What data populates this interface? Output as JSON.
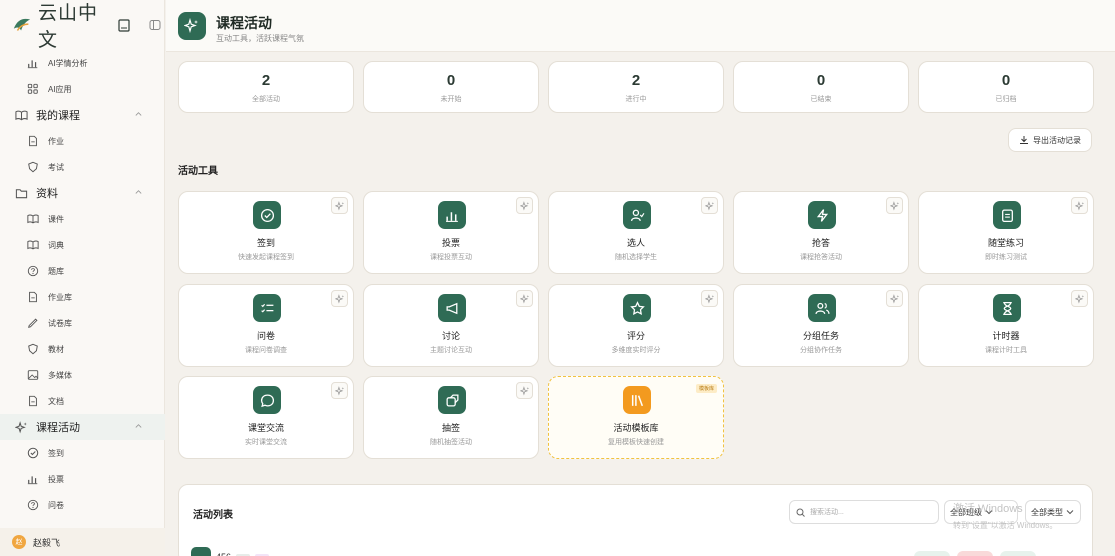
{
  "brand": {
    "name": "云山中文"
  },
  "sidebar": {
    "items": [
      {
        "label": "AI学情分析",
        "icon": "bar-chart-icon",
        "type": "item"
      },
      {
        "label": "AI应用",
        "icon": "grid-icon",
        "type": "item"
      },
      {
        "label": "我的课程",
        "icon": "book-open-icon",
        "type": "group"
      },
      {
        "label": "作业",
        "icon": "file-icon",
        "type": "item"
      },
      {
        "label": "考试",
        "icon": "shield-icon",
        "type": "item"
      },
      {
        "label": "资料",
        "icon": "folder-icon",
        "type": "group"
      },
      {
        "label": "课件",
        "icon": "book-open-icon",
        "type": "item"
      },
      {
        "label": "词典",
        "icon": "book-open-icon",
        "type": "item"
      },
      {
        "label": "题库",
        "icon": "help-circle-icon",
        "type": "item"
      },
      {
        "label": "作业库",
        "icon": "file-icon",
        "type": "item"
      },
      {
        "label": "试卷库",
        "icon": "pen-icon",
        "type": "item"
      },
      {
        "label": "教材",
        "icon": "shield-icon",
        "type": "item"
      },
      {
        "label": "多媒体",
        "icon": "image-icon",
        "type": "item"
      },
      {
        "label": "文档",
        "icon": "file-icon",
        "type": "item"
      },
      {
        "label": "课程活动",
        "icon": "sparkle-icon",
        "type": "group",
        "active": true
      },
      {
        "label": "签到",
        "icon": "check-circle-icon",
        "type": "item"
      },
      {
        "label": "投票",
        "icon": "bar-chart-icon",
        "type": "item"
      },
      {
        "label": "问卷",
        "icon": "help-circle-icon",
        "type": "item"
      }
    ]
  },
  "user": {
    "avatar_initial": "赵",
    "name": "赵毅飞"
  },
  "header": {
    "title": "课程活动",
    "subtitle": "互动工具，活跃课程气氛"
  },
  "stats": [
    {
      "value": "2",
      "label": "全部活动"
    },
    {
      "value": "0",
      "label": "未开始"
    },
    {
      "value": "2",
      "label": "进行中"
    },
    {
      "value": "0",
      "label": "已结束"
    },
    {
      "value": "0",
      "label": "已归档"
    }
  ],
  "export_label": "导出活动记录",
  "tools_title": "活动工具",
  "tools": [
    {
      "name": "签到",
      "desc": "快速发起课程签到",
      "icon": "check-circle-icon"
    },
    {
      "name": "投票",
      "desc": "课程投票互动",
      "icon": "bar-chart-icon"
    },
    {
      "name": "选人",
      "desc": "随机选择学生",
      "icon": "user-pick-icon"
    },
    {
      "name": "抢答",
      "desc": "课程抢答活动",
      "icon": "lightning-icon"
    },
    {
      "name": "随堂练习",
      "desc": "即时练习测试",
      "icon": "clipboard-icon"
    },
    {
      "name": "问卷",
      "desc": "课程问卷调查",
      "icon": "checklist-icon"
    },
    {
      "name": "讨论",
      "desc": "主题讨论互动",
      "icon": "megaphone-icon"
    },
    {
      "name": "评分",
      "desc": "多维度实时评分",
      "icon": "star-icon"
    },
    {
      "name": "分组任务",
      "desc": "分组协作任务",
      "icon": "users-icon"
    },
    {
      "name": "计时器",
      "desc": "课程计时工具",
      "icon": "hourglass-icon"
    },
    {
      "name": "课堂交流",
      "desc": "实时课堂交流",
      "icon": "chat-icon"
    },
    {
      "name": "抽签",
      "desc": "随机抽签活动",
      "icon": "dice-icon"
    },
    {
      "name": "活动模板库",
      "desc": "复用模板快速创建",
      "icon": "library-icon",
      "badge": "模板库"
    }
  ],
  "list": {
    "title": "活动列表",
    "search_placeholder": "搜索活动...",
    "class_filter": "全部班级",
    "type_filter": "全部类型",
    "first_row_label": "456"
  },
  "watermark": {
    "line1": "激活 Windows",
    "line2": "转到\"设置\"以激活 Windows。"
  }
}
